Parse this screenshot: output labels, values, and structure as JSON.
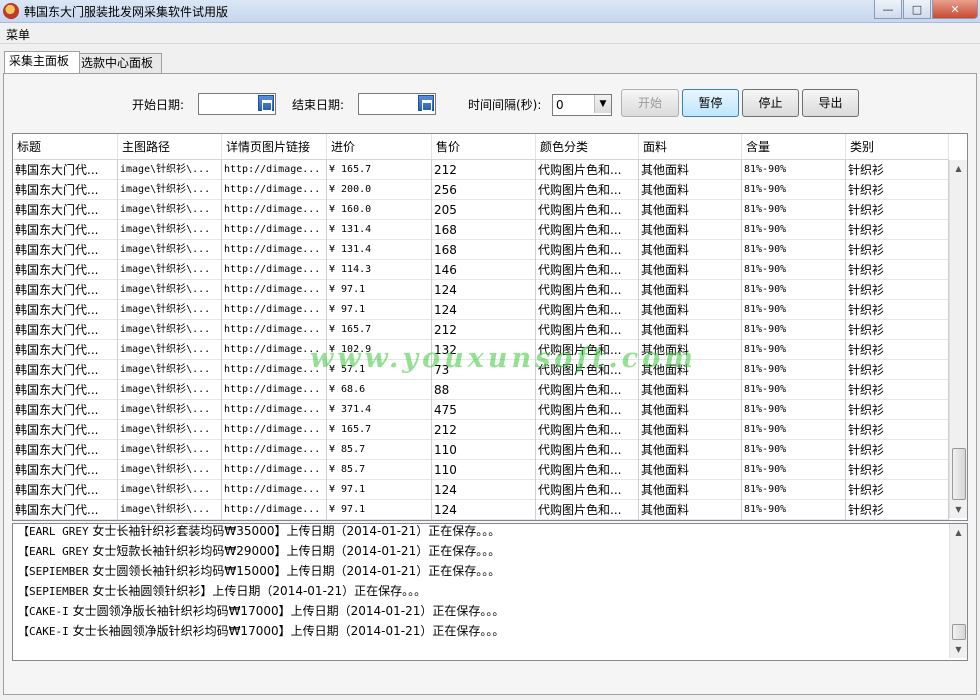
{
  "window": {
    "title": "韩国东大门服装批发网采集软件试用版",
    "controls": [
      "—",
      "□",
      "✕"
    ]
  },
  "menu": {
    "label": "菜单"
  },
  "tabs": [
    "采集主面板",
    "选款中心面板"
  ],
  "controls": {
    "start_date_label": "开始日期:",
    "start_date_value": "",
    "end_date_label": "结束日期:",
    "end_date_value": "",
    "interval_label": "时间间隔(秒):",
    "interval_value": "0",
    "btn_start": "开始",
    "btn_pause": "暂停",
    "btn_stop": "停止",
    "btn_export": "导出"
  },
  "grid": {
    "columns": [
      "标题",
      "主图路径",
      "详情页图片链接",
      "进价",
      "售价",
      "颜色分类",
      "面料",
      "含量",
      "类别"
    ],
    "rows": [
      [
        "韩国东大门代...",
        "image\\针织衫\\...",
        "http://dimage...",
        "¥ 165.7",
        "212",
        "代购图片色和...",
        "其他面料",
        "81%-90%",
        "针织衫"
      ],
      [
        "韩国东大门代...",
        "image\\针织衫\\...",
        "http://dimage...",
        "¥ 200.0",
        "256",
        "代购图片色和...",
        "其他面料",
        "81%-90%",
        "针织衫"
      ],
      [
        "韩国东大门代...",
        "image\\针织衫\\...",
        "http://dimage...",
        "¥ 160.0",
        "205",
        "代购图片色和...",
        "其他面料",
        "81%-90%",
        "针织衫"
      ],
      [
        "韩国东大门代...",
        "image\\针织衫\\...",
        "http://dimage...",
        "¥ 131.4",
        "168",
        "代购图片色和...",
        "其他面料",
        "81%-90%",
        "针织衫"
      ],
      [
        "韩国东大门代...",
        "image\\针织衫\\...",
        "http://dimage...",
        "¥ 131.4",
        "168",
        "代购图片色和...",
        "其他面料",
        "81%-90%",
        "针织衫"
      ],
      [
        "韩国东大门代...",
        "image\\针织衫\\...",
        "http://dimage...",
        "¥ 114.3",
        "146",
        "代购图片色和...",
        "其他面料",
        "81%-90%",
        "针织衫"
      ],
      [
        "韩国东大门代...",
        "image\\针织衫\\...",
        "http://dimage...",
        "¥ 97.1",
        "124",
        "代购图片色和...",
        "其他面料",
        "81%-90%",
        "针织衫"
      ],
      [
        "韩国东大门代...",
        "image\\针织衫\\...",
        "http://dimage...",
        "¥ 97.1",
        "124",
        "代购图片色和...",
        "其他面料",
        "81%-90%",
        "针织衫"
      ],
      [
        "韩国东大门代...",
        "image\\针织衫\\...",
        "http://dimage...",
        "¥ 165.7",
        "212",
        "代购图片色和...",
        "其他面料",
        "81%-90%",
        "针织衫"
      ],
      [
        "韩国东大门代...",
        "image\\针织衫\\...",
        "http://dimage...",
        "¥ 102.9",
        "132",
        "代购图片色和...",
        "其他面料",
        "81%-90%",
        "针织衫"
      ],
      [
        "韩国东大门代...",
        "image\\针织衫\\...",
        "http://dimage...",
        "¥ 57.1",
        "73",
        "代购图片色和...",
        "其他面料",
        "81%-90%",
        "针织衫"
      ],
      [
        "韩国东大门代...",
        "image\\针织衫\\...",
        "http://dimage...",
        "¥ 68.6",
        "88",
        "代购图片色和...",
        "其他面料",
        "81%-90%",
        "针织衫"
      ],
      [
        "韩国东大门代...",
        "image\\针织衫\\...",
        "http://dimage...",
        "¥ 371.4",
        "475",
        "代购图片色和...",
        "其他面料",
        "81%-90%",
        "针织衫"
      ],
      [
        "韩国东大门代...",
        "image\\针织衫\\...",
        "http://dimage...",
        "¥ 165.7",
        "212",
        "代购图片色和...",
        "其他面料",
        "81%-90%",
        "针织衫"
      ],
      [
        "韩国东大门代...",
        "image\\针织衫\\...",
        "http://dimage...",
        "¥ 85.7",
        "110",
        "代购图片色和...",
        "其他面料",
        "81%-90%",
        "针织衫"
      ],
      [
        "韩国东大门代...",
        "image\\针织衫\\...",
        "http://dimage...",
        "¥ 85.7",
        "110",
        "代购图片色和...",
        "其他面料",
        "81%-90%",
        "针织衫"
      ],
      [
        "韩国东大门代...",
        "image\\针织衫\\...",
        "http://dimage...",
        "¥ 97.1",
        "124",
        "代购图片色和...",
        "其他面料",
        "81%-90%",
        "针织衫"
      ],
      [
        "韩国东大门代...",
        "image\\针织衫\\...",
        "http://dimage...",
        "¥ 97.1",
        "124",
        "代购图片色和...",
        "其他面料",
        "81%-90%",
        "针织衫"
      ]
    ]
  },
  "watermark": "www.youxunsoft.com",
  "log": [
    {
      "mono": "【EARL GREY",
      "text": " 女士长袖针织衫套装均码₩35000】上传日期（2014-01-21）正在保存。。。"
    },
    {
      "mono": "【EARL GREY",
      "text": " 女士短款长袖针织衫均码₩29000】上传日期（2014-01-21）正在保存。。。"
    },
    {
      "mono": "【SEPIEMBER",
      "text": " 女士圆领长袖针织衫均码₩15000】上传日期（2014-01-21）正在保存。。。"
    },
    {
      "mono": "【SEPIEMBER",
      "text": " 女士长袖圆领针织衫】上传日期（2014-01-21）正在保存。。。"
    },
    {
      "mono": "【CAKE-I",
      "text": " 女士圆领净版长袖针织衫均码₩17000】上传日期（2014-01-21）正在保存。。。"
    },
    {
      "mono": "【CAKE-I",
      "text": " 女士长袖圆领净版针织衫均码₩17000】上传日期（2014-01-21）正在保存。。。"
    }
  ]
}
